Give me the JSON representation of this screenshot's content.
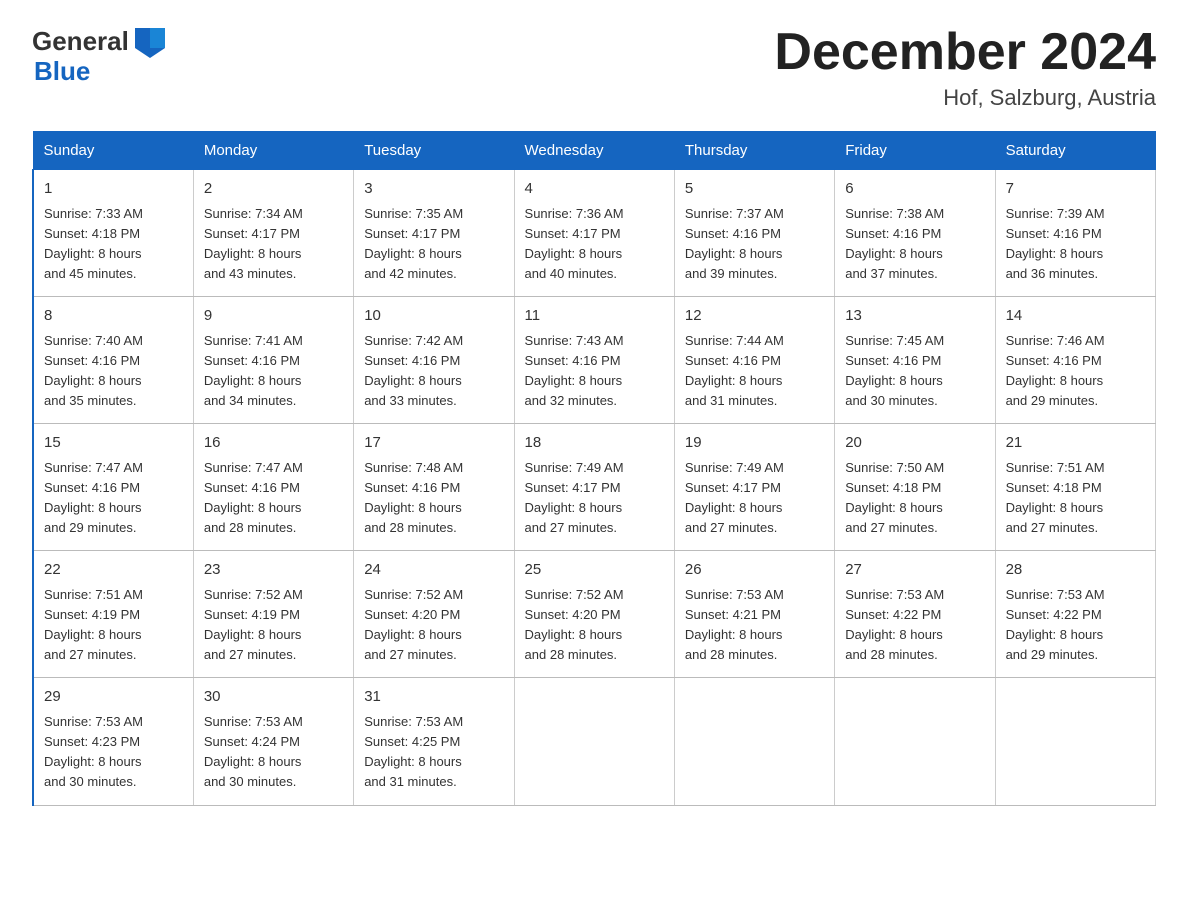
{
  "header": {
    "logo_general": "General",
    "logo_blue": "Blue",
    "title": "December 2024",
    "subtitle": "Hof, Salzburg, Austria"
  },
  "days_of_week": [
    "Sunday",
    "Monday",
    "Tuesday",
    "Wednesday",
    "Thursday",
    "Friday",
    "Saturday"
  ],
  "weeks": [
    [
      {
        "num": "1",
        "sunrise": "7:33 AM",
        "sunset": "4:18 PM",
        "daylight": "8 hours and 45 minutes."
      },
      {
        "num": "2",
        "sunrise": "7:34 AM",
        "sunset": "4:17 PM",
        "daylight": "8 hours and 43 minutes."
      },
      {
        "num": "3",
        "sunrise": "7:35 AM",
        "sunset": "4:17 PM",
        "daylight": "8 hours and 42 minutes."
      },
      {
        "num": "4",
        "sunrise": "7:36 AM",
        "sunset": "4:17 PM",
        "daylight": "8 hours and 40 minutes."
      },
      {
        "num": "5",
        "sunrise": "7:37 AM",
        "sunset": "4:16 PM",
        "daylight": "8 hours and 39 minutes."
      },
      {
        "num": "6",
        "sunrise": "7:38 AM",
        "sunset": "4:16 PM",
        "daylight": "8 hours and 37 minutes."
      },
      {
        "num": "7",
        "sunrise": "7:39 AM",
        "sunset": "4:16 PM",
        "daylight": "8 hours and 36 minutes."
      }
    ],
    [
      {
        "num": "8",
        "sunrise": "7:40 AM",
        "sunset": "4:16 PM",
        "daylight": "8 hours and 35 minutes."
      },
      {
        "num": "9",
        "sunrise": "7:41 AM",
        "sunset": "4:16 PM",
        "daylight": "8 hours and 34 minutes."
      },
      {
        "num": "10",
        "sunrise": "7:42 AM",
        "sunset": "4:16 PM",
        "daylight": "8 hours and 33 minutes."
      },
      {
        "num": "11",
        "sunrise": "7:43 AM",
        "sunset": "4:16 PM",
        "daylight": "8 hours and 32 minutes."
      },
      {
        "num": "12",
        "sunrise": "7:44 AM",
        "sunset": "4:16 PM",
        "daylight": "8 hours and 31 minutes."
      },
      {
        "num": "13",
        "sunrise": "7:45 AM",
        "sunset": "4:16 PM",
        "daylight": "8 hours and 30 minutes."
      },
      {
        "num": "14",
        "sunrise": "7:46 AM",
        "sunset": "4:16 PM",
        "daylight": "8 hours and 29 minutes."
      }
    ],
    [
      {
        "num": "15",
        "sunrise": "7:47 AM",
        "sunset": "4:16 PM",
        "daylight": "8 hours and 29 minutes."
      },
      {
        "num": "16",
        "sunrise": "7:47 AM",
        "sunset": "4:16 PM",
        "daylight": "8 hours and 28 minutes."
      },
      {
        "num": "17",
        "sunrise": "7:48 AM",
        "sunset": "4:16 PM",
        "daylight": "8 hours and 28 minutes."
      },
      {
        "num": "18",
        "sunrise": "7:49 AM",
        "sunset": "4:17 PM",
        "daylight": "8 hours and 27 minutes."
      },
      {
        "num": "19",
        "sunrise": "7:49 AM",
        "sunset": "4:17 PM",
        "daylight": "8 hours and 27 minutes."
      },
      {
        "num": "20",
        "sunrise": "7:50 AM",
        "sunset": "4:18 PM",
        "daylight": "8 hours and 27 minutes."
      },
      {
        "num": "21",
        "sunrise": "7:51 AM",
        "sunset": "4:18 PM",
        "daylight": "8 hours and 27 minutes."
      }
    ],
    [
      {
        "num": "22",
        "sunrise": "7:51 AM",
        "sunset": "4:19 PM",
        "daylight": "8 hours and 27 minutes."
      },
      {
        "num": "23",
        "sunrise": "7:52 AM",
        "sunset": "4:19 PM",
        "daylight": "8 hours and 27 minutes."
      },
      {
        "num": "24",
        "sunrise": "7:52 AM",
        "sunset": "4:20 PM",
        "daylight": "8 hours and 27 minutes."
      },
      {
        "num": "25",
        "sunrise": "7:52 AM",
        "sunset": "4:20 PM",
        "daylight": "8 hours and 28 minutes."
      },
      {
        "num": "26",
        "sunrise": "7:53 AM",
        "sunset": "4:21 PM",
        "daylight": "8 hours and 28 minutes."
      },
      {
        "num": "27",
        "sunrise": "7:53 AM",
        "sunset": "4:22 PM",
        "daylight": "8 hours and 28 minutes."
      },
      {
        "num": "28",
        "sunrise": "7:53 AM",
        "sunset": "4:22 PM",
        "daylight": "8 hours and 29 minutes."
      }
    ],
    [
      {
        "num": "29",
        "sunrise": "7:53 AM",
        "sunset": "4:23 PM",
        "daylight": "8 hours and 30 minutes."
      },
      {
        "num": "30",
        "sunrise": "7:53 AM",
        "sunset": "4:24 PM",
        "daylight": "8 hours and 30 minutes."
      },
      {
        "num": "31",
        "sunrise": "7:53 AM",
        "sunset": "4:25 PM",
        "daylight": "8 hours and 31 minutes."
      },
      null,
      null,
      null,
      null
    ]
  ],
  "labels": {
    "sunrise": "Sunrise:",
    "sunset": "Sunset:",
    "daylight": "Daylight:"
  }
}
